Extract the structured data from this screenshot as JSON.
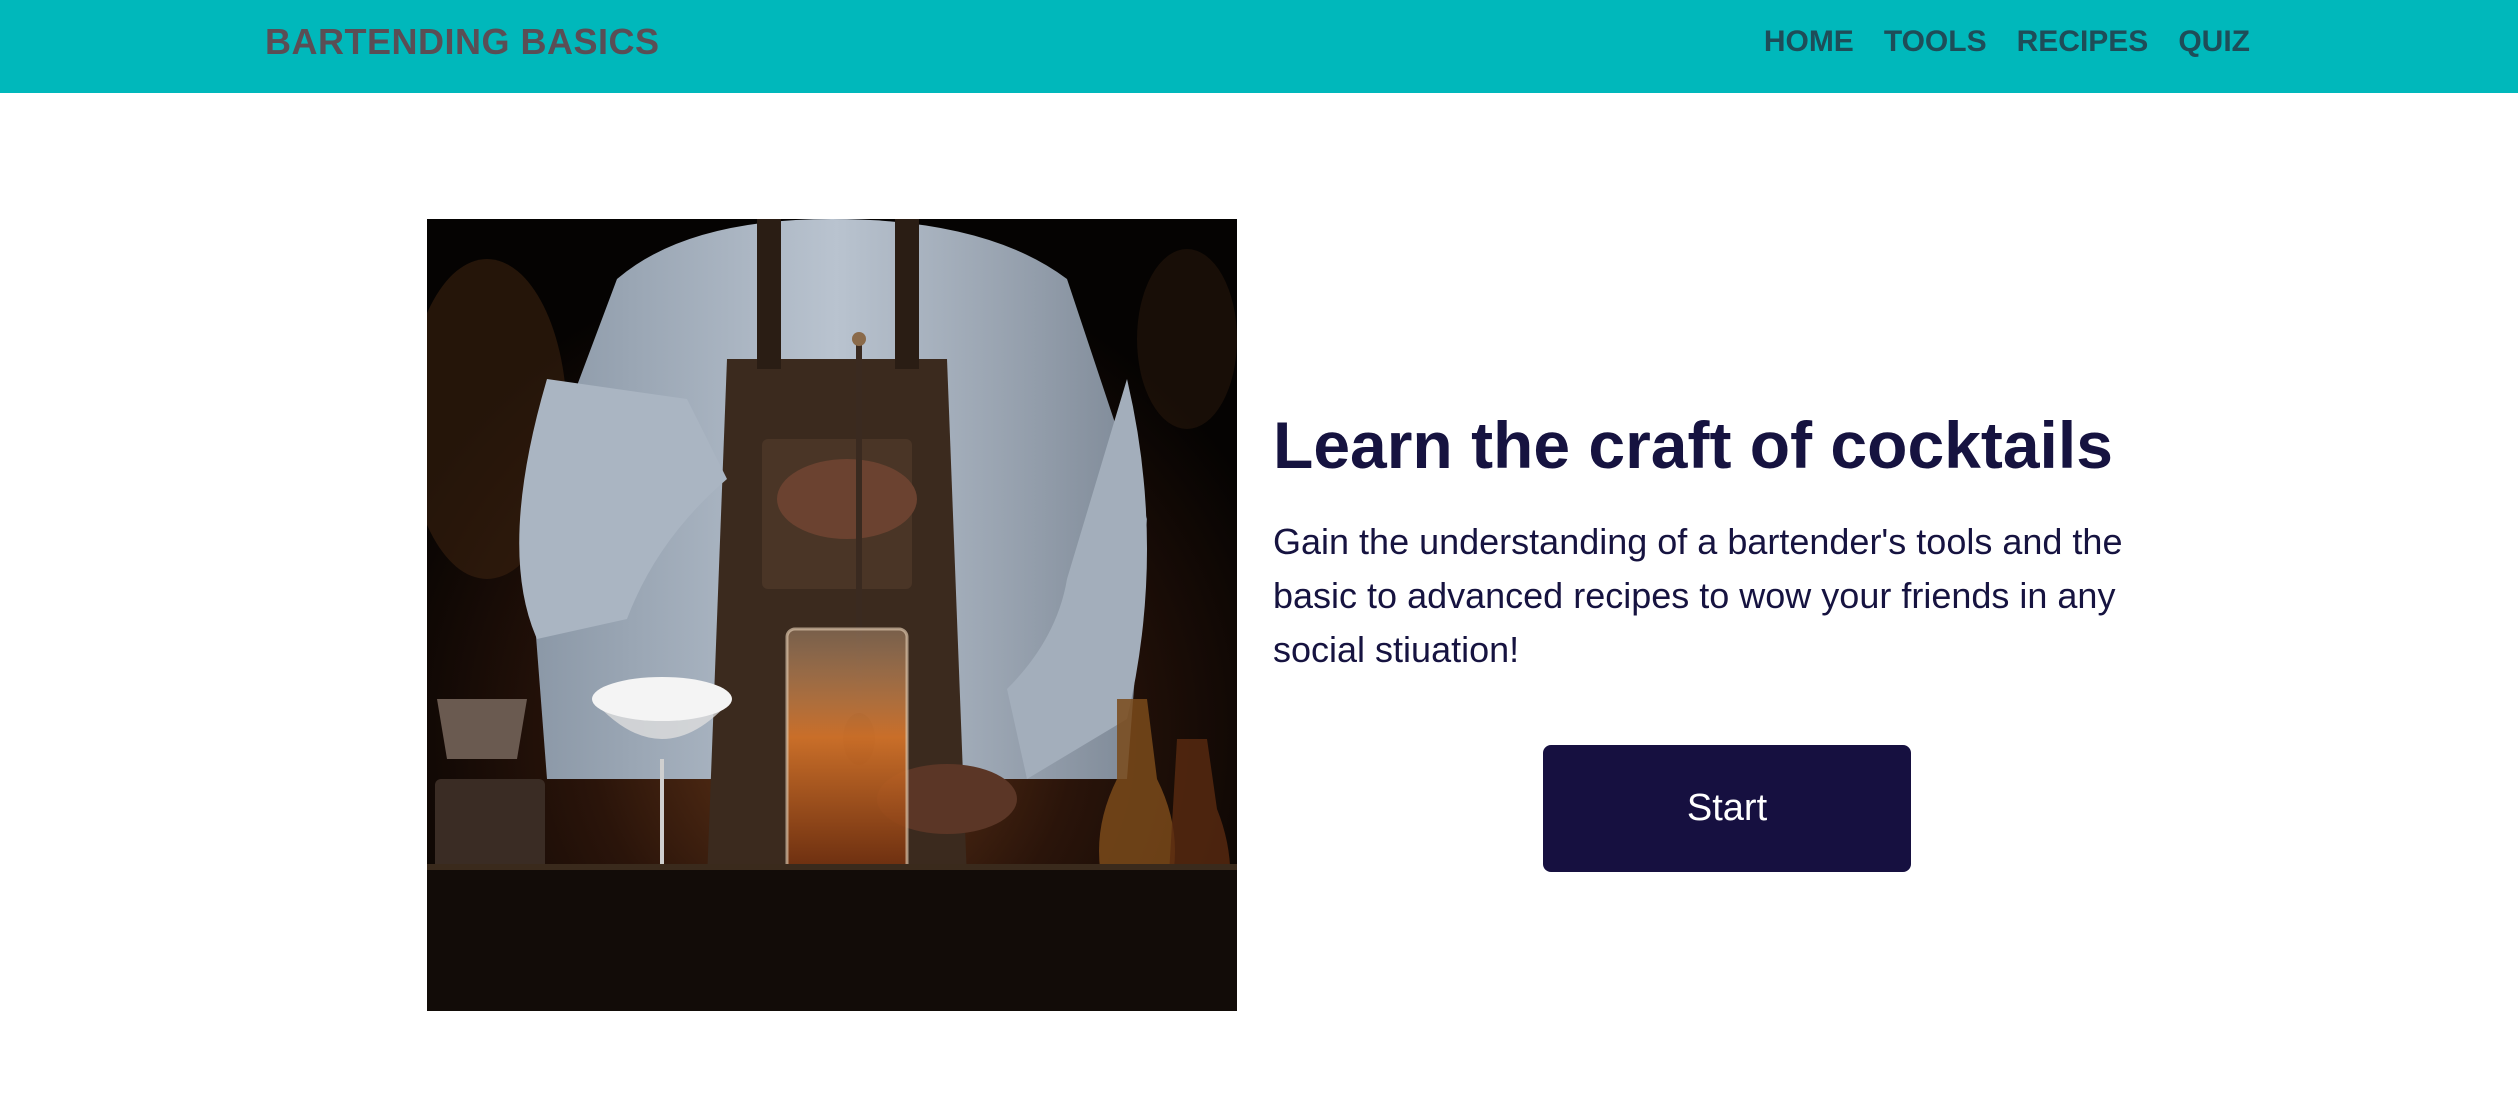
{
  "navbar": {
    "brand": "BARTENDING BASICS",
    "links": [
      {
        "label": "HOME"
      },
      {
        "label": "TOOLS"
      },
      {
        "label": "RECIPES"
      },
      {
        "label": "QUIZ"
      }
    ]
  },
  "hero": {
    "image_subject": "bartender stirring a cocktail in a mixing glass at a dark bar",
    "title": "Learn the craft of cocktails",
    "description": "Gain the understanding of a bartender's tools and the basic to advanced recipes to wow your friends in any social stiuation!",
    "button_label": "Start"
  },
  "colors": {
    "navbar_bg": "#00b8bb",
    "brand_text": "#5a4e55",
    "nav_link_text": "#1e4d58",
    "heading_text": "#161340",
    "button_bg": "#161040",
    "button_text": "#ffffff"
  }
}
